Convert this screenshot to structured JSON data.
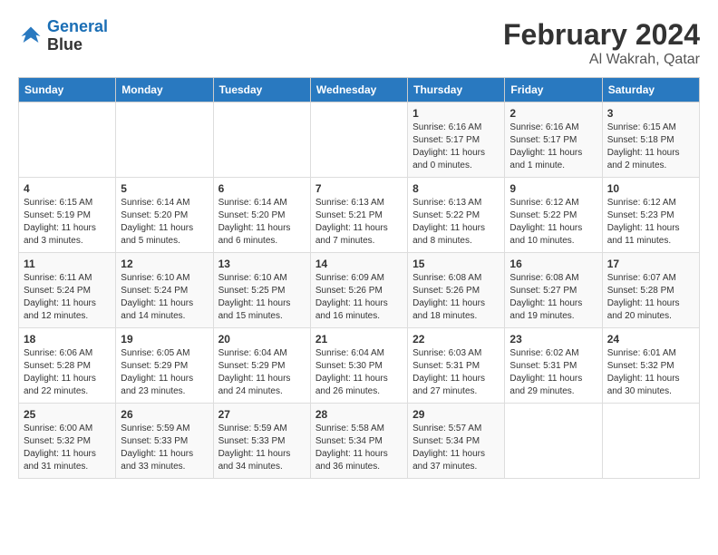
{
  "header": {
    "logo_line1": "General",
    "logo_line2": "Blue",
    "title": "February 2024",
    "subtitle": "Al Wakrah, Qatar"
  },
  "columns": [
    "Sunday",
    "Monday",
    "Tuesday",
    "Wednesday",
    "Thursday",
    "Friday",
    "Saturday"
  ],
  "weeks": [
    [
      {
        "day": "",
        "info": ""
      },
      {
        "day": "",
        "info": ""
      },
      {
        "day": "",
        "info": ""
      },
      {
        "day": "",
        "info": ""
      },
      {
        "day": "1",
        "info": "Sunrise: 6:16 AM\nSunset: 5:17 PM\nDaylight: 11 hours\nand 0 minutes."
      },
      {
        "day": "2",
        "info": "Sunrise: 6:16 AM\nSunset: 5:17 PM\nDaylight: 11 hours\nand 1 minute."
      },
      {
        "day": "3",
        "info": "Sunrise: 6:15 AM\nSunset: 5:18 PM\nDaylight: 11 hours\nand 2 minutes."
      }
    ],
    [
      {
        "day": "4",
        "info": "Sunrise: 6:15 AM\nSunset: 5:19 PM\nDaylight: 11 hours\nand 3 minutes."
      },
      {
        "day": "5",
        "info": "Sunrise: 6:14 AM\nSunset: 5:20 PM\nDaylight: 11 hours\nand 5 minutes."
      },
      {
        "day": "6",
        "info": "Sunrise: 6:14 AM\nSunset: 5:20 PM\nDaylight: 11 hours\nand 6 minutes."
      },
      {
        "day": "7",
        "info": "Sunrise: 6:13 AM\nSunset: 5:21 PM\nDaylight: 11 hours\nand 7 minutes."
      },
      {
        "day": "8",
        "info": "Sunrise: 6:13 AM\nSunset: 5:22 PM\nDaylight: 11 hours\nand 8 minutes."
      },
      {
        "day": "9",
        "info": "Sunrise: 6:12 AM\nSunset: 5:22 PM\nDaylight: 11 hours\nand 10 minutes."
      },
      {
        "day": "10",
        "info": "Sunrise: 6:12 AM\nSunset: 5:23 PM\nDaylight: 11 hours\nand 11 minutes."
      }
    ],
    [
      {
        "day": "11",
        "info": "Sunrise: 6:11 AM\nSunset: 5:24 PM\nDaylight: 11 hours\nand 12 minutes."
      },
      {
        "day": "12",
        "info": "Sunrise: 6:10 AM\nSunset: 5:24 PM\nDaylight: 11 hours\nand 14 minutes."
      },
      {
        "day": "13",
        "info": "Sunrise: 6:10 AM\nSunset: 5:25 PM\nDaylight: 11 hours\nand 15 minutes."
      },
      {
        "day": "14",
        "info": "Sunrise: 6:09 AM\nSunset: 5:26 PM\nDaylight: 11 hours\nand 16 minutes."
      },
      {
        "day": "15",
        "info": "Sunrise: 6:08 AM\nSunset: 5:26 PM\nDaylight: 11 hours\nand 18 minutes."
      },
      {
        "day": "16",
        "info": "Sunrise: 6:08 AM\nSunset: 5:27 PM\nDaylight: 11 hours\nand 19 minutes."
      },
      {
        "day": "17",
        "info": "Sunrise: 6:07 AM\nSunset: 5:28 PM\nDaylight: 11 hours\nand 20 minutes."
      }
    ],
    [
      {
        "day": "18",
        "info": "Sunrise: 6:06 AM\nSunset: 5:28 PM\nDaylight: 11 hours\nand 22 minutes."
      },
      {
        "day": "19",
        "info": "Sunrise: 6:05 AM\nSunset: 5:29 PM\nDaylight: 11 hours\nand 23 minutes."
      },
      {
        "day": "20",
        "info": "Sunrise: 6:04 AM\nSunset: 5:29 PM\nDaylight: 11 hours\nand 24 minutes."
      },
      {
        "day": "21",
        "info": "Sunrise: 6:04 AM\nSunset: 5:30 PM\nDaylight: 11 hours\nand 26 minutes."
      },
      {
        "day": "22",
        "info": "Sunrise: 6:03 AM\nSunset: 5:31 PM\nDaylight: 11 hours\nand 27 minutes."
      },
      {
        "day": "23",
        "info": "Sunrise: 6:02 AM\nSunset: 5:31 PM\nDaylight: 11 hours\nand 29 minutes."
      },
      {
        "day": "24",
        "info": "Sunrise: 6:01 AM\nSunset: 5:32 PM\nDaylight: 11 hours\nand 30 minutes."
      }
    ],
    [
      {
        "day": "25",
        "info": "Sunrise: 6:00 AM\nSunset: 5:32 PM\nDaylight: 11 hours\nand 31 minutes."
      },
      {
        "day": "26",
        "info": "Sunrise: 5:59 AM\nSunset: 5:33 PM\nDaylight: 11 hours\nand 33 minutes."
      },
      {
        "day": "27",
        "info": "Sunrise: 5:59 AM\nSunset: 5:33 PM\nDaylight: 11 hours\nand 34 minutes."
      },
      {
        "day": "28",
        "info": "Sunrise: 5:58 AM\nSunset: 5:34 PM\nDaylight: 11 hours\nand 36 minutes."
      },
      {
        "day": "29",
        "info": "Sunrise: 5:57 AM\nSunset: 5:34 PM\nDaylight: 11 hours\nand 37 minutes."
      },
      {
        "day": "",
        "info": ""
      },
      {
        "day": "",
        "info": ""
      }
    ]
  ]
}
